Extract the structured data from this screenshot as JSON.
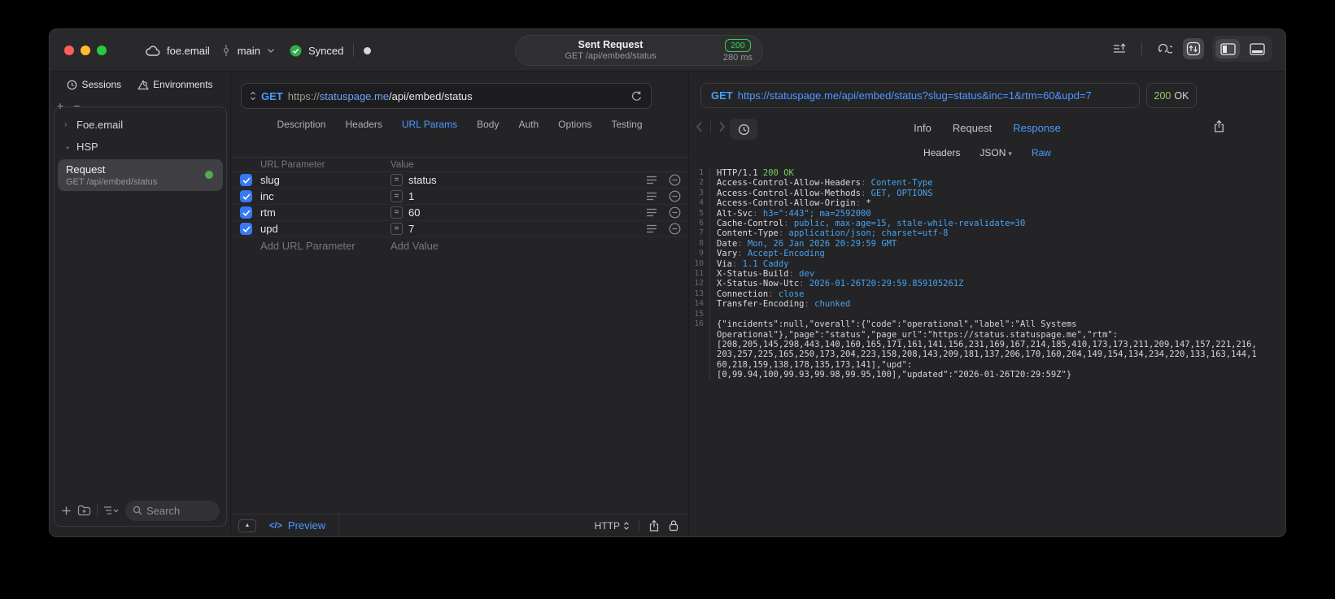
{
  "colors": {
    "accent_blue": "#4a9bff",
    "badge_green": "#32d74b",
    "code_value_blue": "#47a2ee",
    "code_green": "#7dc85c",
    "checkbox_blue": "#3778f6",
    "url_host_blue": "#6fa3f2"
  },
  "titlebar": {
    "project": "foe.email",
    "branch": "main",
    "sync_status": "Synced",
    "center": {
      "title": "Sent Request",
      "subtitle": "GET /api/embed/status",
      "status_code": "200",
      "duration": "280 ms"
    }
  },
  "sidebar": {
    "tabs": [
      {
        "label": "Sessions",
        "icon": "clock-icon"
      },
      {
        "label": "Environments",
        "icon": "environments-icon"
      }
    ],
    "add_label": "+",
    "remove_label": "−",
    "tree": [
      {
        "label": "Foe.email",
        "chevron": "›"
      },
      {
        "label": "HSP",
        "chevron": "⌄"
      }
    ],
    "request_item": {
      "title": "Request",
      "subtitle": "GET /api/embed/status"
    },
    "search_placeholder": "Search"
  },
  "request_panel": {
    "method": "GET",
    "url_scheme": "https://",
    "url_host": "statuspage.me",
    "url_path": "/api/embed/status",
    "tabs": [
      {
        "label": "Description",
        "active": false
      },
      {
        "label": "Headers",
        "active": false
      },
      {
        "label": "URL Params",
        "active": true
      },
      {
        "label": "Body",
        "active": false
      },
      {
        "label": "Auth",
        "active": false
      },
      {
        "label": "Options",
        "active": false
      },
      {
        "label": "Testing",
        "active": false
      }
    ],
    "param_table": {
      "columns": [
        "URL Parameter",
        "Value"
      ],
      "rows": [
        {
          "name": "slug",
          "value": "status",
          "checked": true
        },
        {
          "name": "inc",
          "value": "1",
          "checked": true
        },
        {
          "name": "rtm",
          "value": "60",
          "checked": true
        },
        {
          "name": "upd",
          "value": "7",
          "checked": true
        }
      ],
      "add_name_label": "Add URL Parameter",
      "add_value_label": "Add Value"
    },
    "footer": {
      "preview_label": "Preview",
      "code_glyph": "</>",
      "protocol": "HTTP"
    }
  },
  "response_panel": {
    "request_line": {
      "method": "GET",
      "url": "https://statuspage.me/api/embed/status?slug=status&inc=1&rtm=60&upd=7"
    },
    "status": {
      "code": "200",
      "text": "OK"
    },
    "tabs": [
      {
        "label": "Info",
        "active": false
      },
      {
        "label": "Request",
        "active": false
      },
      {
        "label": "Response",
        "active": true
      }
    ],
    "subtabs": [
      {
        "label": "Headers",
        "active": false,
        "dropdown": false
      },
      {
        "label": "JSON",
        "active": false,
        "dropdown": true
      },
      {
        "label": "Raw",
        "active": true,
        "dropdown": false
      }
    ],
    "code_lines": [
      {
        "num": "1",
        "segments": [
          {
            "t": "HTTP/1.1 ",
            "c": "k"
          },
          {
            "t": "200 OK",
            "c": "g"
          }
        ]
      },
      {
        "num": "2",
        "segments": [
          {
            "t": "Access-Control-Allow-Headers",
            "c": "k"
          },
          {
            "t": ": ",
            "c": "p"
          },
          {
            "t": "Content-Type",
            "c": "v"
          }
        ]
      },
      {
        "num": "3",
        "segments": [
          {
            "t": "Access-Control-Allow-Methods",
            "c": "k"
          },
          {
            "t": ": ",
            "c": "p"
          },
          {
            "t": "GET, OPTIONS",
            "c": "v"
          }
        ]
      },
      {
        "num": "4",
        "segments": [
          {
            "t": "Access-Control-Allow-Origin",
            "c": "k"
          },
          {
            "t": ": ",
            "c": "p"
          },
          {
            "t": "*",
            "c": "k"
          }
        ]
      },
      {
        "num": "5",
        "segments": [
          {
            "t": "Alt-Svc",
            "c": "k"
          },
          {
            "t": ": ",
            "c": "p"
          },
          {
            "t": "h3=\":443\"; ma=2592000",
            "c": "v"
          }
        ]
      },
      {
        "num": "6",
        "segments": [
          {
            "t": "Cache-Control",
            "c": "k"
          },
          {
            "t": ": ",
            "c": "p"
          },
          {
            "t": "public, max-age=15, stale-while-revalidate=30",
            "c": "v"
          }
        ]
      },
      {
        "num": "7",
        "segments": [
          {
            "t": "Content-Type",
            "c": "k"
          },
          {
            "t": ": ",
            "c": "p"
          },
          {
            "t": "application/json; charset=utf-8",
            "c": "v"
          }
        ]
      },
      {
        "num": "8",
        "segments": [
          {
            "t": "Date",
            "c": "k"
          },
          {
            "t": ": ",
            "c": "p"
          },
          {
            "t": "Mon, 26 Jan 2026 20:29:59 GMT",
            "c": "v"
          }
        ]
      },
      {
        "num": "9",
        "segments": [
          {
            "t": "Vary",
            "c": "k"
          },
          {
            "t": ": ",
            "c": "p"
          },
          {
            "t": "Accept-Encoding",
            "c": "v"
          }
        ]
      },
      {
        "num": "10",
        "segments": [
          {
            "t": "Via",
            "c": "k"
          },
          {
            "t": ": ",
            "c": "p"
          },
          {
            "t": "1.1 Caddy",
            "c": "v"
          }
        ]
      },
      {
        "num": "11",
        "segments": [
          {
            "t": "X-Status-Build",
            "c": "k"
          },
          {
            "t": ": ",
            "c": "p"
          },
          {
            "t": "dev",
            "c": "v"
          }
        ]
      },
      {
        "num": "12",
        "segments": [
          {
            "t": "X-Status-Now-Utc",
            "c": "k"
          },
          {
            "t": ": ",
            "c": "p"
          },
          {
            "t": "2026-01-26T20:29:59.859105261Z",
            "c": "v"
          }
        ]
      },
      {
        "num": "13",
        "segments": [
          {
            "t": "Connection",
            "c": "k"
          },
          {
            "t": ": ",
            "c": "p"
          },
          {
            "t": "close",
            "c": "v"
          }
        ]
      },
      {
        "num": "14",
        "segments": [
          {
            "t": "Transfer-Encoding",
            "c": "k"
          },
          {
            "t": ": ",
            "c": "p"
          },
          {
            "t": "chunked",
            "c": "v"
          }
        ]
      },
      {
        "num": "15",
        "segments": []
      },
      {
        "num": "16",
        "segments": [
          {
            "t": "{\"incidents\":null,\"overall\":{\"code\":\"operational\",\"label\":\"All Systems",
            "c": "b"
          }
        ]
      },
      {
        "num": "",
        "segments": [
          {
            "t": "Operational\"},\"page\":\"status\",\"page_url\":\"https://status.statuspage.me\",\"rtm\":",
            "c": "b"
          }
        ]
      },
      {
        "num": "",
        "segments": [
          {
            "t": "[208,205,145,298,443,140,160,165,171,161,141,156,231,169,167,214,185,410,173,173,211,209,147,157,221,216,",
            "c": "b"
          }
        ]
      },
      {
        "num": "",
        "segments": [
          {
            "t": "203,257,225,165,250,173,204,223,158,208,143,209,181,137,206,170,160,204,149,154,134,234,220,133,163,144,1",
            "c": "b"
          }
        ]
      },
      {
        "num": "",
        "segments": [
          {
            "t": "60,218,159,138,178,135,173,141],\"upd\":",
            "c": "b"
          }
        ]
      },
      {
        "num": "",
        "segments": [
          {
            "t": "[0,99.94,100,99.93,99.98,99.95,100],\"updated\":\"2026-01-26T20:29:59Z\"}",
            "c": "b"
          }
        ]
      }
    ]
  }
}
